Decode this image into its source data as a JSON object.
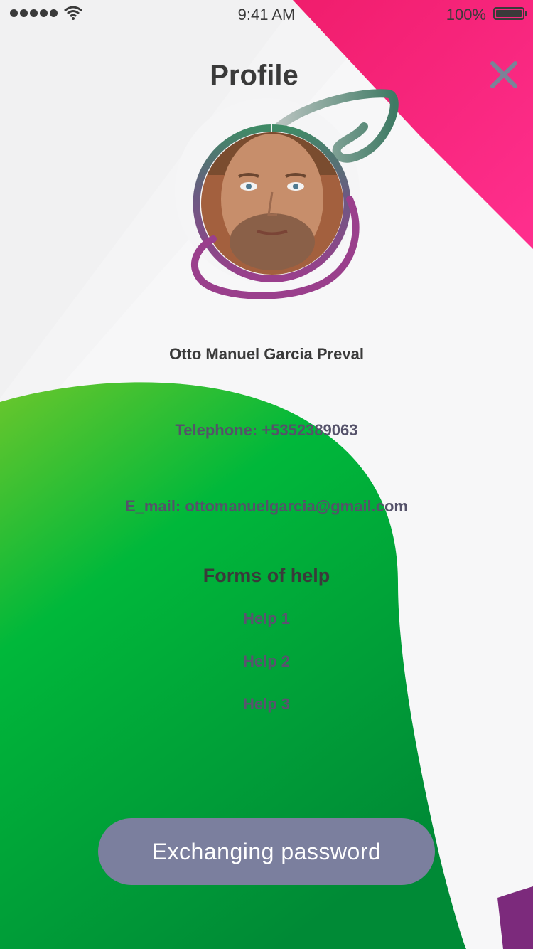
{
  "status_bar": {
    "time": "9:41 AM",
    "battery": "100%"
  },
  "header": {
    "title": "Profile",
    "close_icon": "close-icon"
  },
  "profile": {
    "name": "Otto Manuel Garcia Preval",
    "telephone": "Telephone: +5352389063",
    "email": "E_mail: ottomanuelgarcia@gmail.com"
  },
  "help": {
    "title": "Forms of help",
    "items": [
      {
        "label": "Help 1"
      },
      {
        "label": "Help 2"
      },
      {
        "label": "Help 3"
      }
    ]
  },
  "actions": {
    "primary_label": "Exchanging password"
  },
  "colors": {
    "pink": "#f7227c",
    "green": "#00b83a",
    "purple": "#7c2a7c",
    "teal": "#3f7d69",
    "button": "#7b7f9e",
    "text": "#3a3a3a"
  }
}
